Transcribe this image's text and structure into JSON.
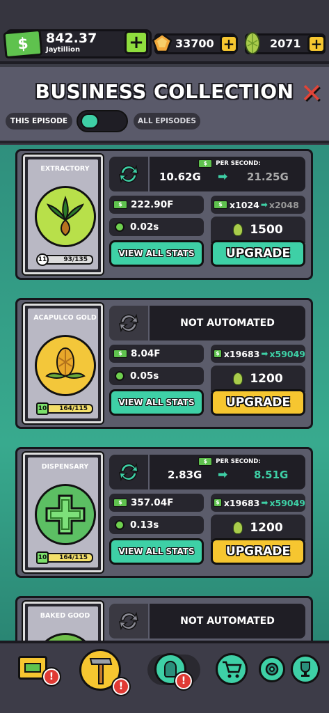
{
  "topbar": {
    "cash_icon": "dollar-bill-icon",
    "money_value": "842.37",
    "money_unit": "Jaytillion",
    "gem_value": "33700",
    "bud_value": "2071"
  },
  "header": {
    "title": "BUSINESS COLLECTION",
    "toggle_left": "THIS EPISODE",
    "toggle_right": "ALL EPISODES"
  },
  "cards": [
    {
      "name": "EXTRACTORY",
      "level": "11",
      "progress": "93/135",
      "automated": true,
      "per_second_label": "PER SECOND:",
      "per_second_from": "10.62G",
      "per_second_to": "21.25G",
      "revenue": "222.90F",
      "multiplier_from": "x1024",
      "multiplier_to": "x2048",
      "time": "0.02s",
      "cost": "1500",
      "view_label": "VIEW ALL STATS",
      "upgrade_label": "UPGRADE"
    },
    {
      "name": "ACAPULCO GOLD",
      "level": "10",
      "progress": "164/115",
      "automated": false,
      "not_automated_label": "NOT AUTOMATED",
      "revenue": "8.04F",
      "multiplier_from": "x19683",
      "multiplier_to": "x59049",
      "time": "0.05s",
      "cost": "1200",
      "view_label": "VIEW ALL STATS",
      "upgrade_label": "UPGRADE"
    },
    {
      "name": "DISPENSARY",
      "level": "10",
      "progress": "164/115",
      "automated": true,
      "per_second_label": "PER SECOND:",
      "per_second_from": "2.83G",
      "per_second_to": "8.51G",
      "revenue": "357.04F",
      "multiplier_from": "x19683",
      "multiplier_to": "x59049",
      "time": "0.13s",
      "cost": "1200",
      "view_label": "VIEW ALL STATS",
      "upgrade_label": "UPGRADE"
    },
    {
      "name": "BAKED GOOD",
      "not_automated_label": "NOT AUTOMATED"
    }
  ],
  "nav": {
    "badge_text": "!"
  },
  "colors": {
    "teal": "#3ed0a6",
    "gold": "#f6c630",
    "green": "#8fde3e",
    "alert": "#e03a34"
  }
}
